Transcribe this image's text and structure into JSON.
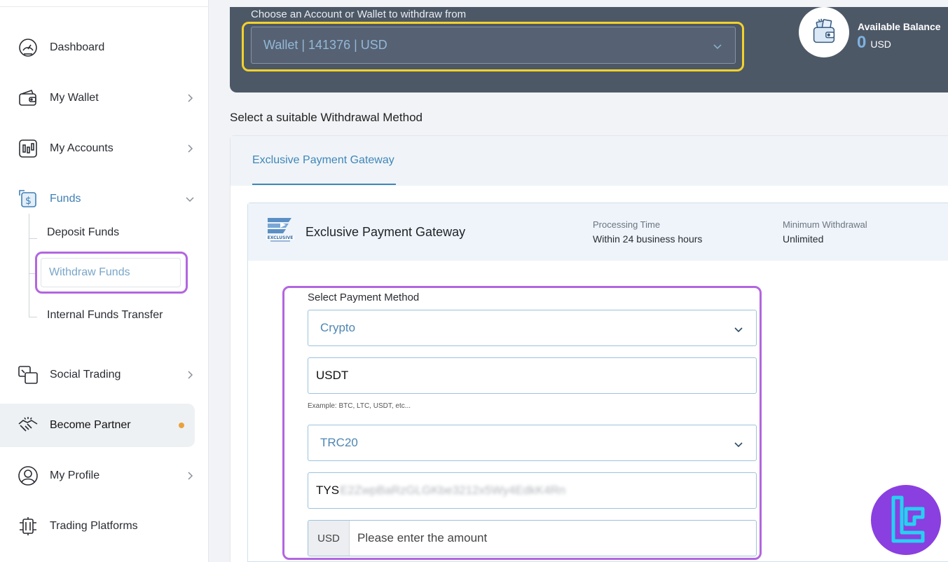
{
  "sidebar": {
    "items": [
      {
        "label": "Dashboard"
      },
      {
        "label": "My Wallet"
      },
      {
        "label": "My Accounts"
      },
      {
        "label": "Funds"
      },
      {
        "label": "Social Trading"
      },
      {
        "label": "Become Partner"
      },
      {
        "label": "My Profile"
      },
      {
        "label": "Trading Platforms"
      }
    ],
    "funds_sub": [
      {
        "label": "Deposit Funds"
      },
      {
        "label": "Withdraw Funds"
      },
      {
        "label": "Internal Funds Transfer"
      }
    ],
    "partner_dot_color": "#e9a23b"
  },
  "account": {
    "label": "Choose an Account or Wallet to withdraw from",
    "selected": "Wallet | 141376 | USD"
  },
  "balance": {
    "label": "Available Balance",
    "amount": "0",
    "currency": "USD"
  },
  "method_section": {
    "title": "Select a suitable Withdrawal Method",
    "tab_label": "Exclusive Payment Gateway"
  },
  "gateway": {
    "name": "Exclusive Payment Gateway",
    "processing_label": "Processing Time",
    "processing_value": "Within 24 business hours",
    "min_label": "Minimum Withdrawal",
    "min_value": "Unlimited"
  },
  "form": {
    "payment_method_label": "Select Payment Method",
    "payment_method_value": "Crypto",
    "currency_value": "USDT",
    "currency_hint": "Example: BTC, LTC, USDT, etc...",
    "network_value": "TRC20",
    "address_prefix": "TYS",
    "address_rest": "E2ZwpBaRzGLGKbe3212x5Wy4EdkK4Rn",
    "amount_currency": "USD",
    "amount_placeholder": "Please enter the amount"
  },
  "colors": {
    "accent": "#3f86b8",
    "highlight_yellow": "#f2d22c",
    "highlight_purple": "#b266e0",
    "panel_dark": "#4d5867"
  }
}
